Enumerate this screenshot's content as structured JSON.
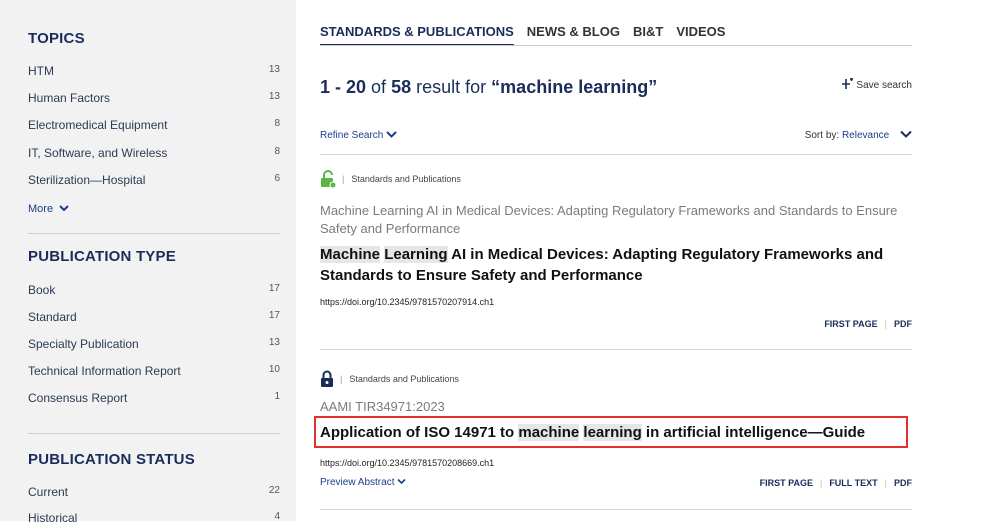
{
  "sidebar": {
    "topics": {
      "title": "TOPICS",
      "items": [
        {
          "label": "HTM",
          "count": "13"
        },
        {
          "label": "Human Factors",
          "count": "13"
        },
        {
          "label": "Electromedical Equipment",
          "count": "8"
        },
        {
          "label": "IT, Software, and Wireless",
          "count": "8"
        },
        {
          "label": "Sterilization—Hospital",
          "count": "6"
        }
      ],
      "more_label": "More"
    },
    "publication_type": {
      "title": "PUBLICATION TYPE",
      "items": [
        {
          "label": "Book",
          "count": "17"
        },
        {
          "label": "Standard",
          "count": "17"
        },
        {
          "label": "Specialty Publication",
          "count": "13"
        },
        {
          "label": "Technical Information Report",
          "count": "10"
        },
        {
          "label": "Consensus Report",
          "count": "1"
        }
      ]
    },
    "publication_status": {
      "title": "PUBLICATION STATUS",
      "items": [
        {
          "label": "Current",
          "count": "22"
        },
        {
          "label": "Historical",
          "count": "4"
        }
      ]
    }
  },
  "tabs": [
    "STANDARDS & PUBLICATIONS",
    "NEWS & BLOG",
    "BI&T",
    "VIDEOS"
  ],
  "results": {
    "range": "1 - 20",
    "of": "of",
    "total": "58",
    "result_for": "result for",
    "query": "“machine learning”",
    "save_search": "Save search",
    "refine_label": "Refine Search",
    "sort_label": "Sort by:",
    "sort_value": "Relevance"
  },
  "items": [
    {
      "category": "Standards and Publications",
      "subtitle": "Machine Learning AI in Medical Devices: Adapting Regulatory Frameworks and Standards to Ensure Safety and Performance",
      "title_hl1": "Machine",
      "title_hl2": "Learning",
      "title_rest": " AI in Medical Devices: Adapting Regulatory Frameworks and Standards to Ensure Safety and Performance",
      "doi": "https://doi.org/10.2345/9781570207914.ch1",
      "first_page": "FIRST PAGE",
      "pdf": "PDF",
      "lock_color": "#5bb544"
    },
    {
      "category": "Standards and Publications",
      "subtitle": "AAMI TIR34971:2023",
      "title_pre": "Application of ISO 14971 to ",
      "title_hl1": "machine",
      "title_hl2": "learning",
      "title_post": " in artificial intelligence—Guide",
      "doi": "https://doi.org/10.2345/9781570208669.ch1",
      "preview": "Preview Abstract",
      "first_page": "FIRST PAGE",
      "full_text": "FULL TEXT",
      "pdf": "PDF",
      "lock_color": "#1a2d5a"
    }
  ]
}
